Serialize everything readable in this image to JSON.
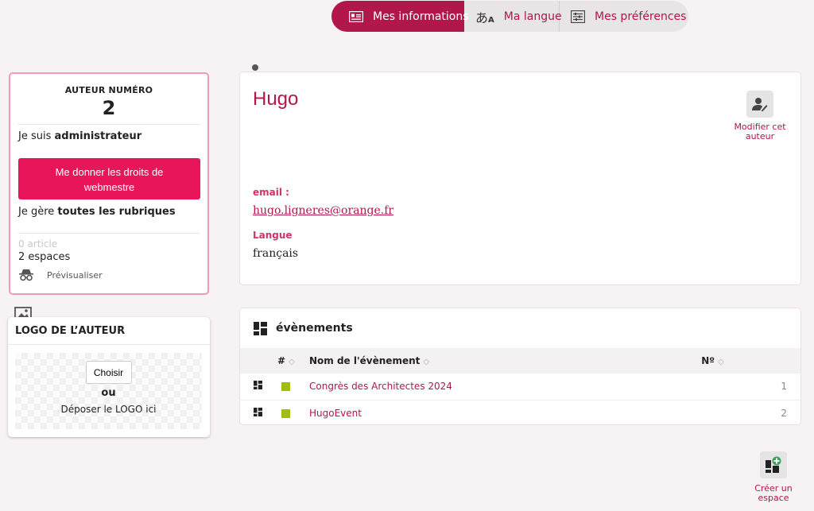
{
  "tabs": [
    {
      "label": "Mes informations",
      "icon": "id-card-icon",
      "active": true
    },
    {
      "label": "Ma langue",
      "icon": "translate-icon",
      "active": false
    },
    {
      "label": "Mes préférences",
      "icon": "sliders-icon",
      "active": false
    }
  ],
  "author_card": {
    "kicker": "AUTEUR NUMÉRO",
    "number": "2",
    "role_prefix": "Je suis",
    "role": "administrateur",
    "webmaster_button": "Me donner les droits de webmestre",
    "rubrics_prefix": "Je gère",
    "rubrics": "toutes les rubriques",
    "articles": "0 article",
    "spaces": "2 espaces",
    "preview": "Prévisualiser"
  },
  "logo_card": {
    "title": "LOGO DE L’AUTEUR",
    "choose_button": "Choisir",
    "or": "ou",
    "drop_text": "Déposer le LOGO ici"
  },
  "author": {
    "name": "Hugo",
    "edit_label": "Modifier cet auteur",
    "email_label": "email :",
    "email": "hugo.ligneres@orange.fr",
    "language_label": "Langue",
    "language": "français"
  },
  "events": {
    "title": "évènements",
    "columns": [
      "#",
      "Nom de l'évènement",
      "Nº"
    ],
    "rows": [
      {
        "name": "Congrès des Architectes 2024",
        "num": "1",
        "color": "#9fbd12"
      },
      {
        "name": "HugoEvent",
        "num": "2",
        "color": "#9fbd12"
      }
    ]
  },
  "create_space": {
    "label": "Créer un espace"
  },
  "colors": {
    "accent": "#b0174a",
    "button": "#e8155b",
    "tag": "#9fbd12"
  }
}
